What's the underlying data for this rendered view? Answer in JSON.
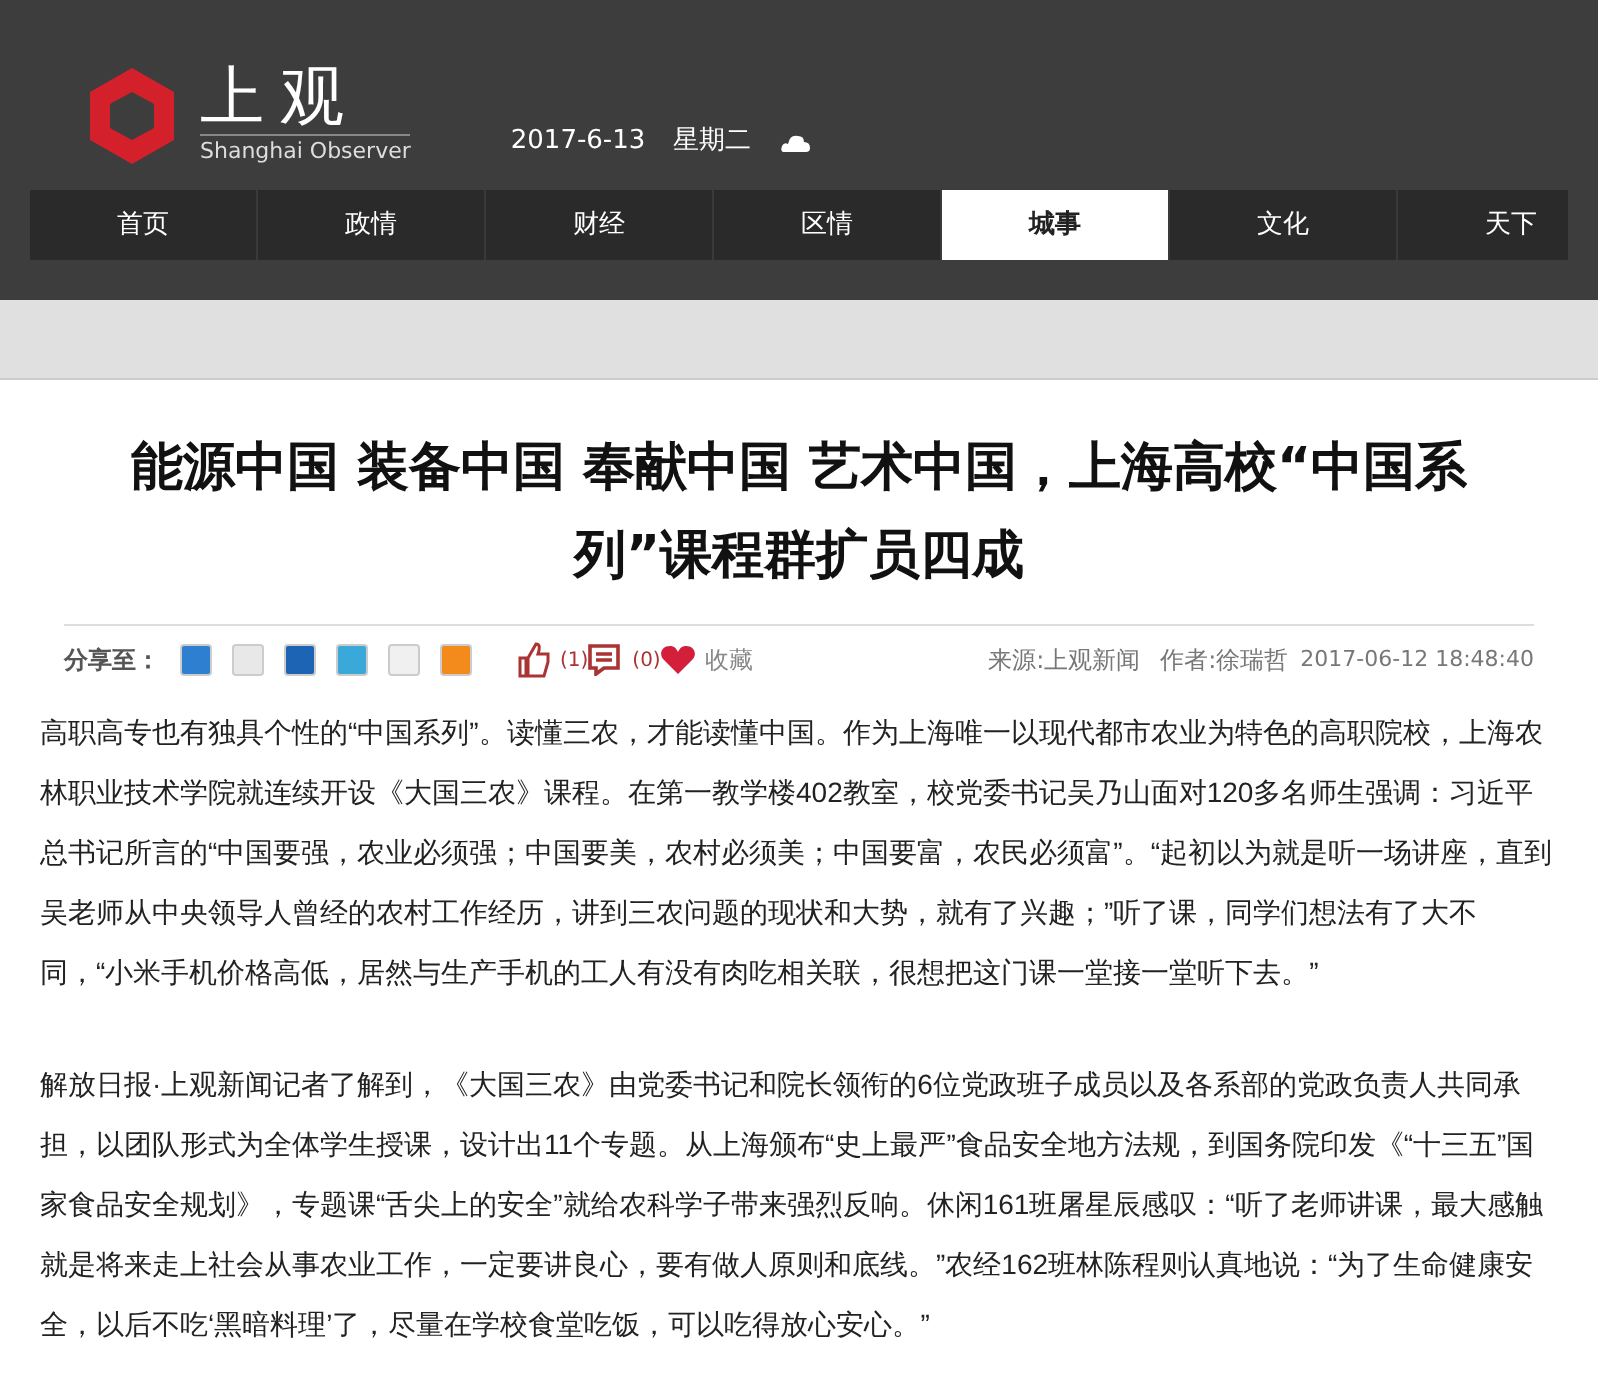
{
  "header": {
    "logo_text": "上观",
    "logo_subtitle": "Shanghai Observer",
    "date": "2017-6-13",
    "weekday": "星期二"
  },
  "nav": [
    {
      "label": "首页",
      "selected": false
    },
    {
      "label": "政情",
      "selected": false
    },
    {
      "label": "财经",
      "selected": false
    },
    {
      "label": "区情",
      "selected": false
    },
    {
      "label": "城事",
      "selected": true
    },
    {
      "label": "文化",
      "selected": false
    },
    {
      "label": "天下",
      "selected": false
    }
  ],
  "article": {
    "title": "能源中国 装备中国 奉献中国 艺术中国，上海高校“中国系列”课程群扩员四成",
    "share_label": "分享至：",
    "share_targets": [
      {
        "color": "#2f7fd0"
      },
      {
        "color": "#e8e8e8"
      },
      {
        "color": "#1e64b4"
      },
      {
        "color": "#3aa8d8"
      },
      {
        "color": "#f0f0f0"
      },
      {
        "color": "#f28a1c"
      }
    ],
    "like_count": "(1)",
    "comment_count": "(0)",
    "favorite_label": "收藏",
    "source": "来源:上观新闻",
    "author": "作者:徐瑞哲",
    "published": "2017-06-12 18:48:40",
    "paragraphs": [
      "高职高专也有独具个性的“中国系列”。读懂三农，才能读懂中国。作为上海唯一以现代都市农业为特色的高职院校，上海农林职业技术学院就连续开设《大国三农》课程。在第一教学楼402教室，校党委书记吴乃山面对120多名师生强调：习近平总书记所言的“中国要强，农业必须强；中国要美，农村必须美；中国要富，农民必须富”。“起初以为就是听一场讲座，直到吴老师从中央领导人曾经的农村工作经历，讲到三农问题的现状和大势，就有了兴趣；”听了课，同学们想法有了大不同，“小米手机价格高低，居然与生产手机的工人有没有肉吃相关联，很想把这门课一堂接一堂听下去。”",
      "解放日报·上观新闻记者了解到，《大国三农》由党委书记和院长领衔的6位党政班子成员以及各系部的党政负责人共同承担，以团队形式为全体学生授课，设计出11个专题。从上海颁布“史上最严”食品安全地方法规，到国务院印发《“十三五”国家食品安全规划》，专题课“舌尖上的安全”就给农科学子带来强烈反响。休闲161班屠星辰感叹：“听了老师讲课，最大感触就是将来走上社会从事农业工作，一定要讲良心，要有做人原则和底线。”农经162班林陈程则认真地说：“为了生命健康安全，以后不吃‘黑暗料理’了，尽量在学校食堂吃饭，可以吃得放心安心。”"
    ]
  }
}
